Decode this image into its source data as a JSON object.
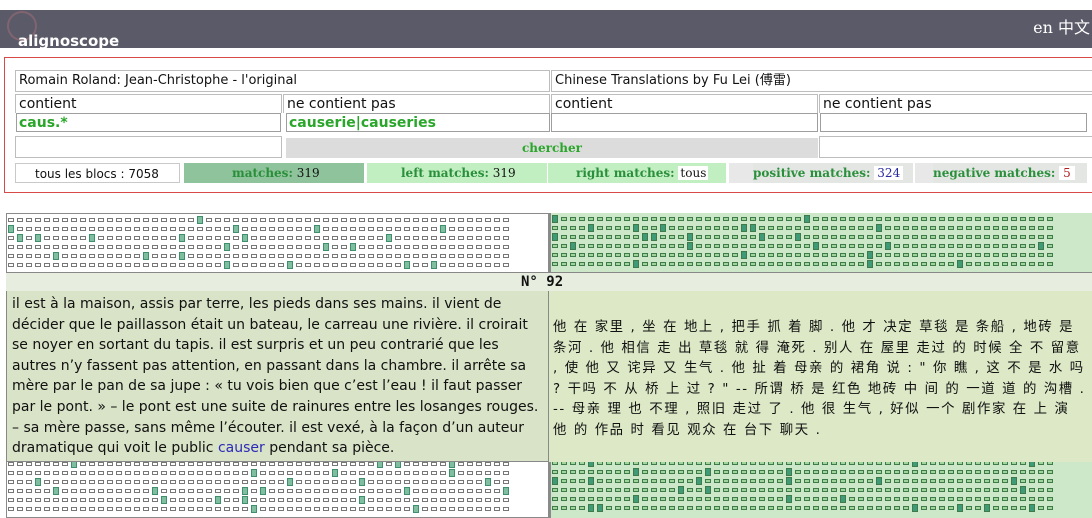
{
  "header": {
    "app_name": "alignoscope",
    "lang_en": "en",
    "lang_zh": "中文"
  },
  "search": {
    "left_title": "Romain Roland: Jean-Christophe - l'original",
    "right_title": "Chinese Translations by Fu Lei (傅雷)",
    "contains_label": "contient",
    "not_contains_label": "ne contient pas",
    "left_contains_value": "caus.*",
    "left_not_contains_value": "causerie|causeries",
    "right_contains_value": "",
    "right_not_contains_value": "",
    "search_button": "chercher"
  },
  "stats": {
    "all_blocks_label": "tous les blocs :",
    "all_blocks_value": "7058",
    "matches_label": "matches:",
    "matches_value": "319",
    "left_matches_label": "left matches:",
    "left_matches_value": "319",
    "right_matches_label": "right matches:",
    "right_matches_value": "tous",
    "positive_matches_label": "positive matches:",
    "positive_matches_value": "324",
    "negative_matches_label": "negative matches:",
    "negative_matches_value": "5"
  },
  "alignment": {
    "block_number": "N° 92",
    "left_text_before": "il est à la maison, assis par terre, les pieds dans ses mains. il vient de décider que le paillasson était un bateau, le carreau une rivière. il croirait se noyer en sortant du tapis. il est surpris et un peu contrarié que les autres n’y fassent pas attention, en passant dans la chambre. il arrête sa mère par le pan de sa jupe : « tu vois bien que c’est l’eau ! il faut passer par le pont. » – le pont est une suite de rainures entre les losanges rouges. – sa mère passe, sans même l’écouter. il est vexé, à la façon d’un auteur dramatique qui voit le public ",
    "left_text_highlight": "causer",
    "left_text_after": " pendant sa pièce.",
    "right_text": "他 在 家里 , 坐 在 地上 , 把手 抓 着 脚 . 他 才 决定 草毯 是 条船 , 地砖 是 条河 . 他 相信 走 出 草毯 就 得 淹死 . 别人 在 屋里 走过 的 时候 全 不 留意 , 使 他 又 诧异 又 生气 . 他 扯 着 母亲 的 裙角 说 : \" 你 瞧 , 这 不 是 水 吗 ? 干吗 不 从 桥 上 过 ? \" -- 所谓 桥 是 红色 地砖 中 间 的 一道 道 的 沟槽 . -- 母亲 理 也 不理 , 照旧 走过 了 . 他 很 生气 , 好似 一个 剧作家 在 上 演 他 的 作品 时 看见 观众 在 台下 聊天 ."
  }
}
